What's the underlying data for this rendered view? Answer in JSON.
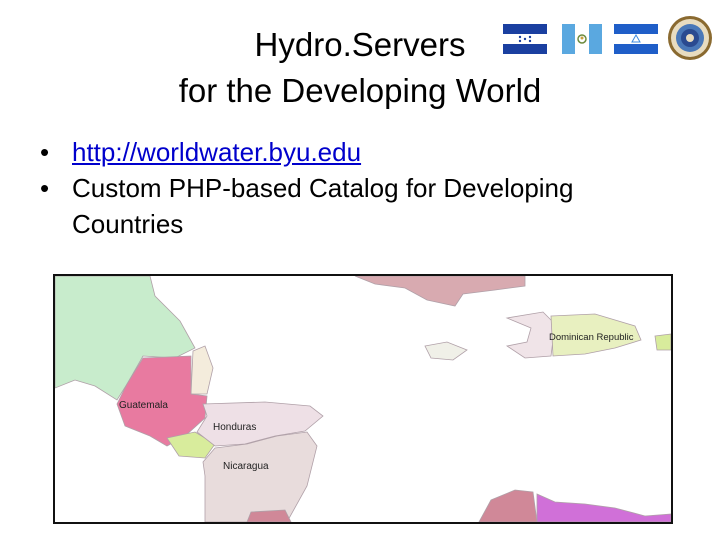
{
  "title": {
    "line1": "Hydro.Servers",
    "line2": "for the Developing World"
  },
  "flags": [
    {
      "name": "Honduras",
      "icon": "honduras-flag-icon"
    },
    {
      "name": "Guatemala",
      "icon": "guatemala-flag-icon"
    },
    {
      "name": "Nicaragua",
      "icon": "nicaragua-flag-icon"
    },
    {
      "name": "OAS",
      "icon": "oas-seal-icon"
    }
  ],
  "bullets": [
    {
      "marker": "•",
      "text": "http://worldwater.byu.edu",
      "is_link": true
    },
    {
      "marker": "•",
      "text": "Custom PHP-based Catalog for Developing Countries",
      "is_link": false
    }
  ],
  "map": {
    "labels": {
      "guatemala": "Guatemala",
      "honduras": "Honduras",
      "nicaragua": "Nicaragua",
      "dominican_republic": "Dominican Republic"
    },
    "colors": {
      "guatemala": "#e87aa0",
      "mexico": "#c8eccc",
      "belize": "#f4ecdc",
      "honduras": "#eee0e6",
      "el_salvador": "#d8ec9c",
      "nicaragua": "#e8dcdc",
      "cuba": "#d8aab0",
      "hispaniola_west": "#f0e4e8",
      "dominican_republic": "#e8f0c0",
      "venezuela": "#d070d8",
      "colombia": "#d08898",
      "jamaica": "#f0f0e8",
      "water": "#ffffff",
      "border": "#b0a0a8"
    }
  }
}
